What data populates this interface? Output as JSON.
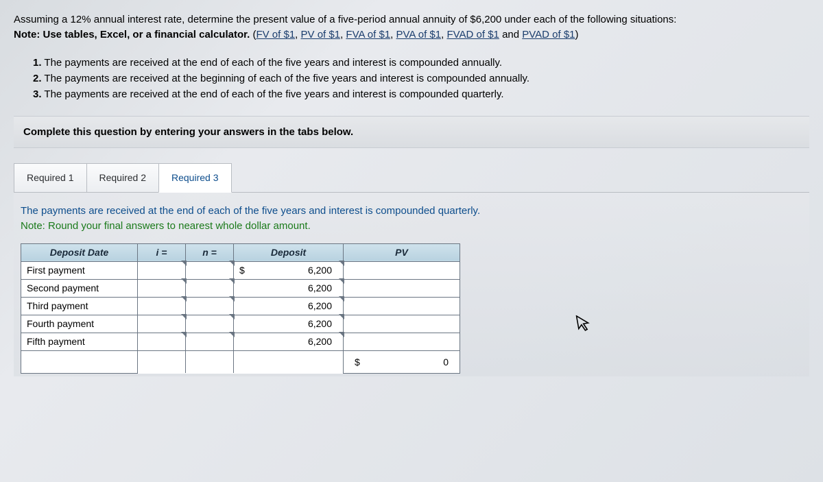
{
  "prompt": {
    "line1": "Assuming a 12% annual interest rate, determine the present value of a five-period annual annuity of $6,200 under each of the following situations:",
    "note_label": "Note: Use tables, Excel, or a financial calculator.",
    "link1": "FV of $1",
    "link2": "PV of $1",
    "link3": "FVA of $1",
    "link4": "PVA of $1",
    "link5": "FVAD of $1",
    "and": "and",
    "link6": "PVAD of $1",
    "open": "(",
    "close": ")",
    "sep": ", "
  },
  "list": {
    "i1": "The payments are received at the end of each of the five years and interest is compounded annually.",
    "i2": "The payments are received at the beginning of each of the five years and interest is compounded annually.",
    "i3": "The payments are received at the end of each of the five years and interest is compounded quarterly.",
    "n1": "1.",
    "n2": "2.",
    "n3": "3."
  },
  "instruction": "Complete this question by entering your answers in the tabs below.",
  "tabs": {
    "t1": "Required 1",
    "t2": "Required 2",
    "t3": "Required 3"
  },
  "tabBody": {
    "desc": "The payments are received at the end of each of the five years and interest is compounded quarterly.",
    "hint": "Note: Round your final answers to nearest whole dollar amount."
  },
  "table": {
    "h_date": "Deposit Date",
    "h_i": "i =",
    "h_n": "n =",
    "h_dep": "Deposit",
    "h_pv": "PV",
    "rows": [
      {
        "date": "First payment",
        "i": "",
        "n": "",
        "dep_sigil": "$",
        "dep": "6,200",
        "pv": ""
      },
      {
        "date": "Second payment",
        "i": "",
        "n": "",
        "dep_sigil": "",
        "dep": "6,200",
        "pv": ""
      },
      {
        "date": "Third payment",
        "i": "",
        "n": "",
        "dep_sigil": "",
        "dep": "6,200",
        "pv": ""
      },
      {
        "date": "Fourth payment",
        "i": "",
        "n": "",
        "dep_sigil": "",
        "dep": "6,200",
        "pv": ""
      },
      {
        "date": "Fifth payment",
        "i": "",
        "n": "",
        "dep_sigil": "",
        "dep": "6,200",
        "pv": ""
      }
    ],
    "total_sigil": "$",
    "total_pv": "0"
  }
}
